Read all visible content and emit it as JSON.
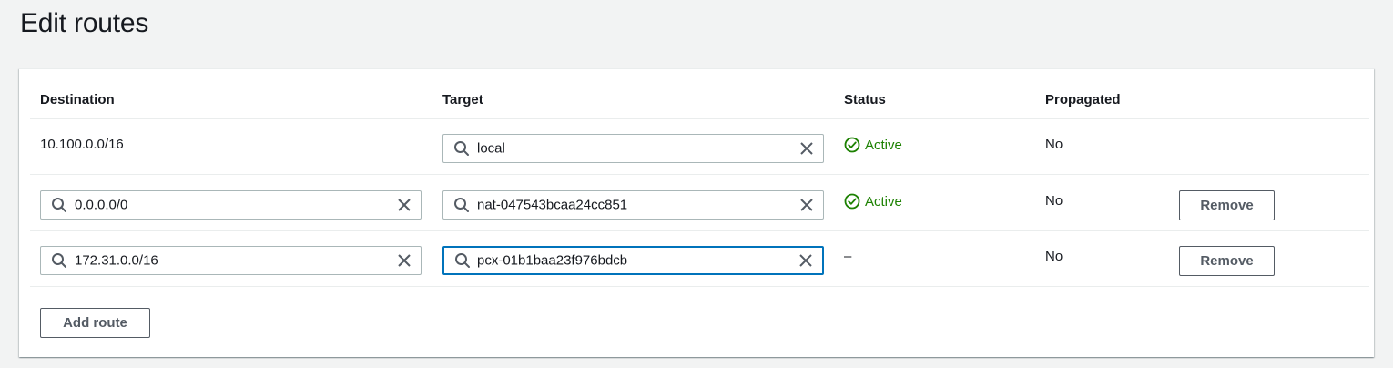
{
  "page": {
    "title": "Edit routes"
  },
  "table": {
    "headers": {
      "destination": "Destination",
      "target": "Target",
      "status": "Status",
      "propagated": "Propagated"
    },
    "rows": [
      {
        "destination": "10.100.0.0/16",
        "target": "local",
        "status": "Active",
        "propagated": "No"
      },
      {
        "destination": "0.0.0.0/0",
        "target": "nat-047543bcaa24cc851",
        "status": "Active",
        "propagated": "No",
        "remove_label": "Remove"
      },
      {
        "destination": "172.31.0.0/16",
        "target": "pcx-01b1baa23f976bdcb",
        "status": "–",
        "propagated": "No",
        "remove_label": "Remove"
      }
    ]
  },
  "actions": {
    "add_route_label": "Add route"
  },
  "colors": {
    "status_active": "#1d8102",
    "focus_border": "#0073bb",
    "page_background": "#f2f3f3"
  },
  "icons": {
    "search": "search-icon",
    "clear": "close-icon",
    "status_active": "check-circle-icon"
  }
}
